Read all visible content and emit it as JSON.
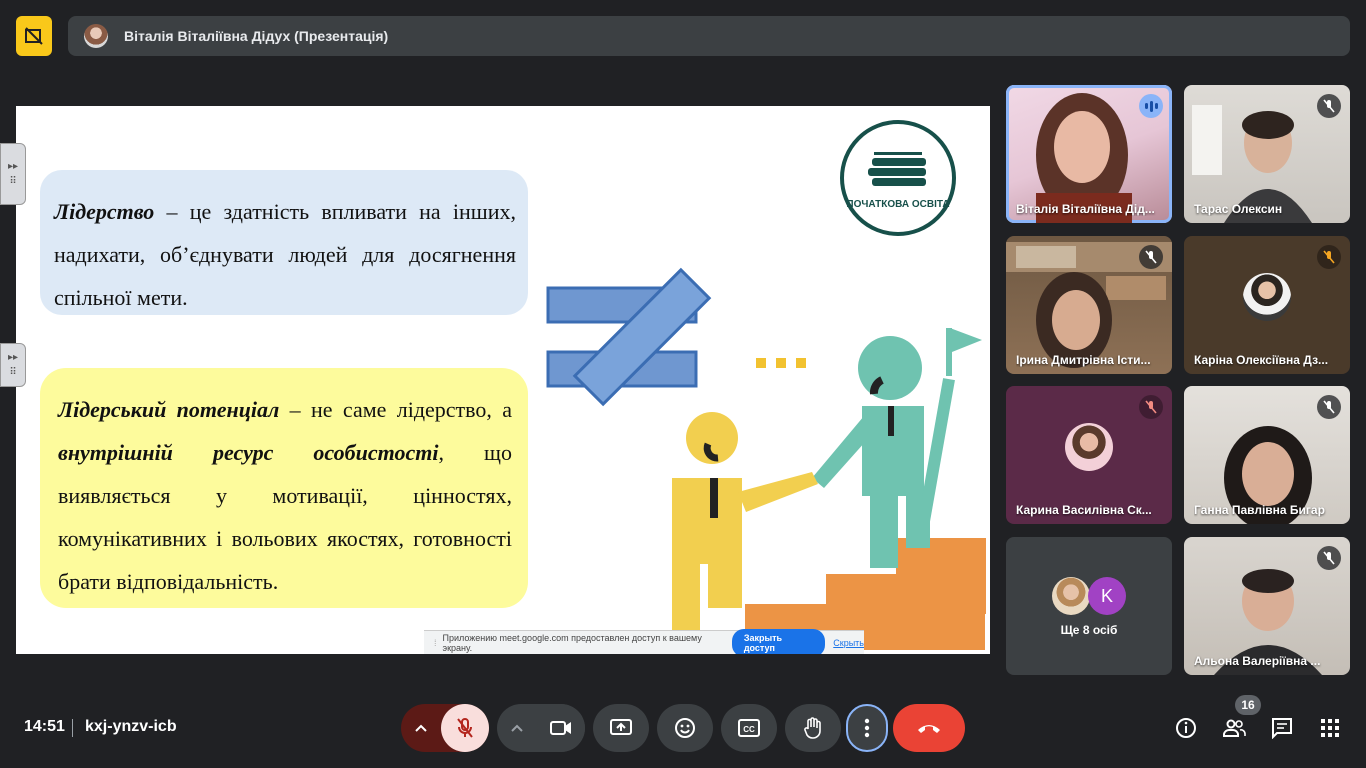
{
  "header": {
    "app_logo_icon": "no-camera-icon",
    "presenter_title": "Віталія Віталіївна Дідух (Презентація)"
  },
  "slide": {
    "box1": {
      "term": "Лідерство",
      "text": " – це здатність впливати на інших, надихати, об’єднувати людей для досягнення спільної мети."
    },
    "box2": {
      "term": "Лідерський потенціал",
      "text_a": " – не саме лідерство, а ",
      "term2": "внутрішній ресурс особистості",
      "text_b": ", що виявляється у мотивації, цінностях, комунікативних і вольових якостях, готовності брати відповідальність."
    },
    "logo_text": "ПОЧАТКОВА ОСВІТА",
    "share_bar": {
      "message": "Приложению meet.google.com предоставлен доступ к вашему экрану.",
      "stop_label": "Закрыть доступ",
      "hide_label": "Скрыть"
    }
  },
  "participants": [
    {
      "name": "Віталія Віталіївна Дід...",
      "speaking": true,
      "muted": false
    },
    {
      "name": "Тарас Олексин",
      "muted": true
    },
    {
      "name": "Ірина Дмитрівна Істи...",
      "muted": true
    },
    {
      "name": "Каріна Олексіївна Дз...",
      "muted": true
    },
    {
      "name": "Карина Василівна Ск...",
      "muted": true
    },
    {
      "name": "Ганна Павлівна Бигар",
      "muted": true
    },
    {
      "name": "Альона Валеріївна ...",
      "muted": true
    }
  ],
  "more_tile": {
    "label": "Ще 8 осіб",
    "avatar_letter": "K"
  },
  "bottom": {
    "time": "14:51",
    "meeting_code": "kxj-ynzv-icb",
    "participants_count": "16"
  },
  "colors": {
    "accent_yellow": "#f9c81a",
    "hangup_red": "#ea4335",
    "mic_off_bg": "#f9dedc",
    "speaking_blue": "#8ab4f8"
  }
}
